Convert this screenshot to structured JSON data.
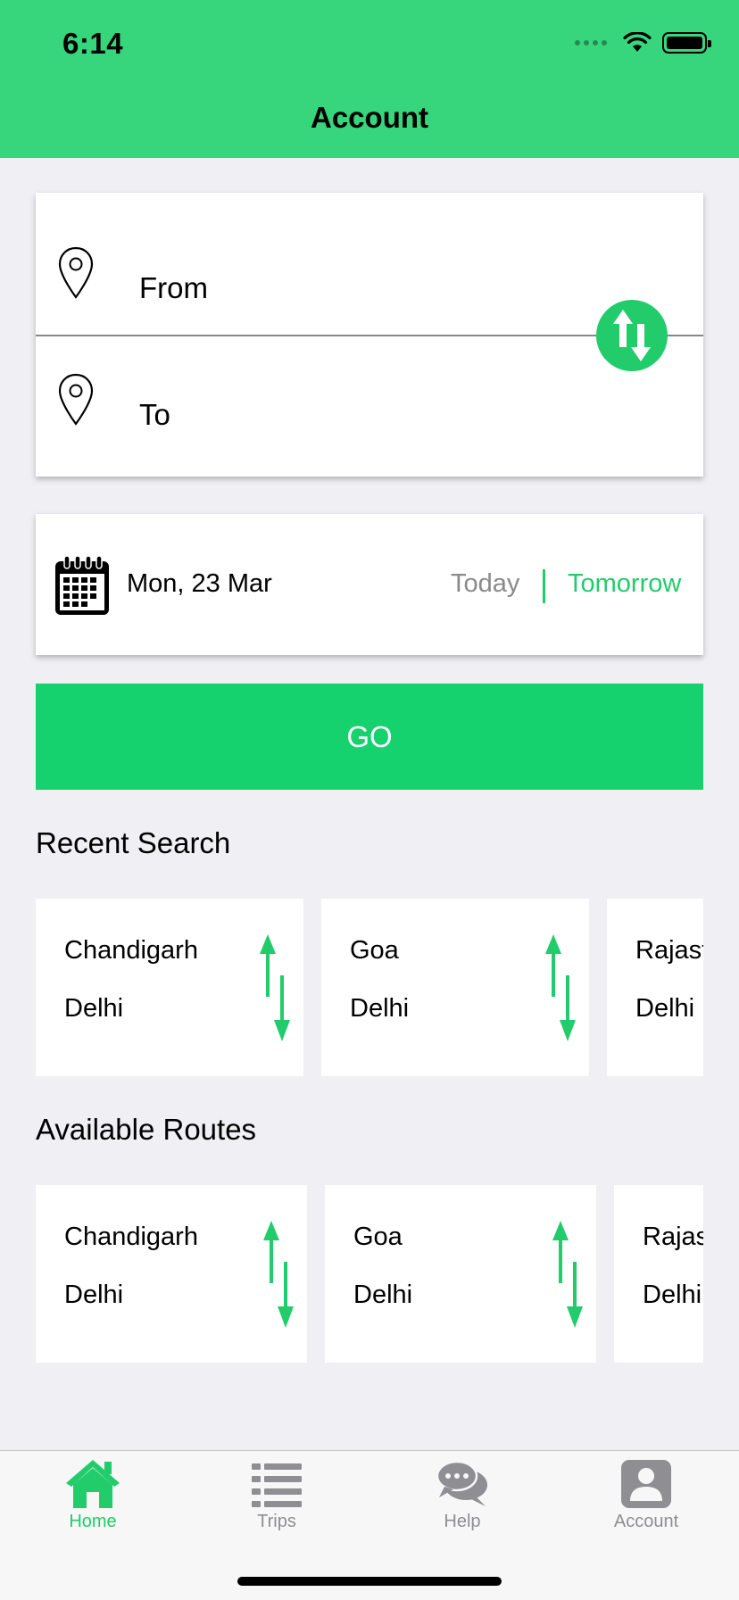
{
  "status_bar": {
    "time": "6:14"
  },
  "nav": {
    "title": "Account"
  },
  "search": {
    "from_label": "From",
    "to_label": "To",
    "date": "Mon, 23 Mar",
    "today_label": "Today",
    "tomorrow_label": "Tomorrow",
    "go_label": "GO"
  },
  "recent_search": {
    "title": "Recent Search",
    "items": [
      {
        "from": "Chandigarh",
        "to": "Delhi"
      },
      {
        "from": "Goa",
        "to": "Delhi"
      },
      {
        "from": "Rajast",
        "to": "Delhi"
      }
    ]
  },
  "available_routes": {
    "title": "Available Routes",
    "items": [
      {
        "from": "Chandigarh",
        "to": "Delhi"
      },
      {
        "from": "Goa",
        "to": "Delhi"
      },
      {
        "from": "Rajas",
        "to": "Delhi"
      }
    ]
  },
  "tab_bar": {
    "tabs": [
      {
        "label": "Home",
        "icon": "home-icon",
        "active": true
      },
      {
        "label": "Trips",
        "icon": "list-icon",
        "active": false
      },
      {
        "label": "Help",
        "icon": "chat-bubbles-icon",
        "active": false
      },
      {
        "label": "Account",
        "icon": "account-icon",
        "active": false
      }
    ]
  },
  "colors": {
    "accent": "#22cc6a",
    "header": "#37d67d",
    "inactive": "#8e8e93"
  }
}
